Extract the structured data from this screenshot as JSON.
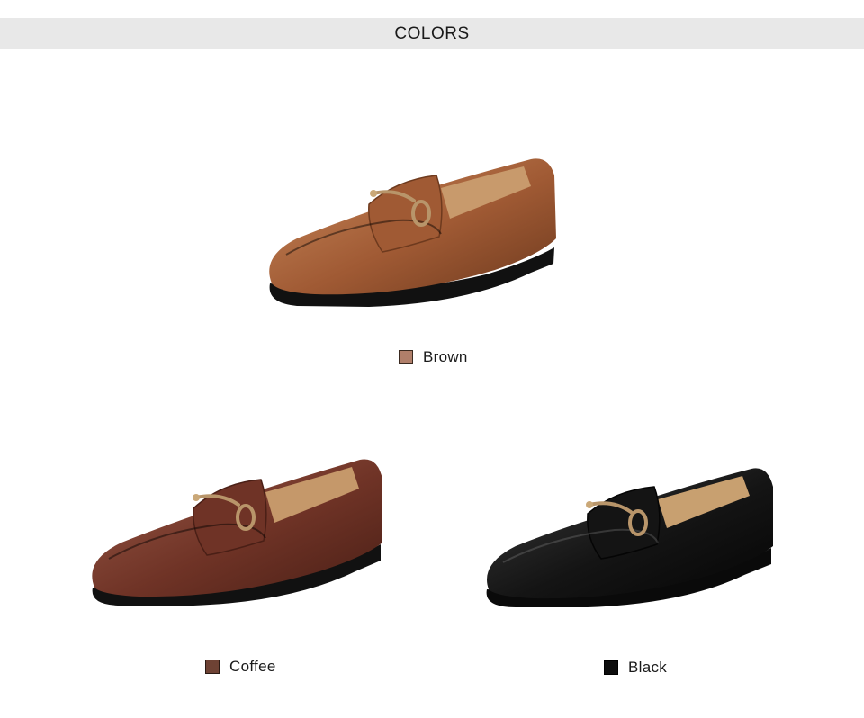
{
  "header": {
    "title": "COLORS"
  },
  "products": [
    {
      "label": "Brown",
      "swatch_color": "#b07f6a",
      "upper_color": "#a05a34",
      "upper_light": "#c98a5c",
      "upper_dark": "#6e3a1e",
      "lining_color": "#c89a6c"
    },
    {
      "label": "Coffee",
      "swatch_color": "#6e4234",
      "upper_color": "#6f3326",
      "upper_light": "#9a5a48",
      "upper_dark": "#4a1f16",
      "lining_color": "#c5986a"
    },
    {
      "label": "Black",
      "swatch_color": "#0d0d0d",
      "upper_color": "#141414",
      "upper_light": "#3c3c3c",
      "upper_dark": "#050505",
      "lining_color": "#c8a070"
    }
  ]
}
